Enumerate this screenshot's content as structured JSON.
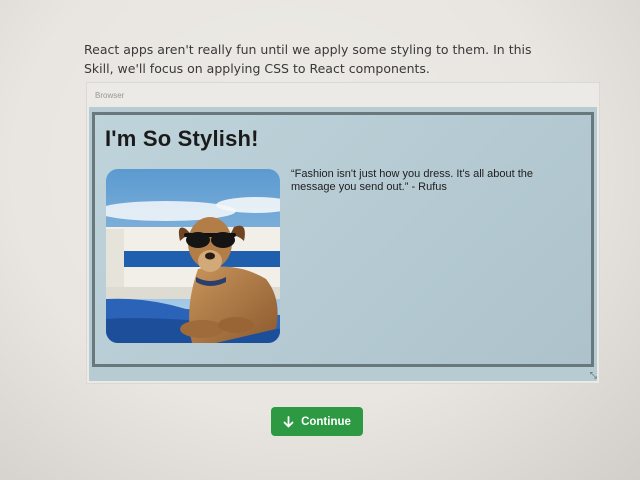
{
  "intro": {
    "text": "React apps aren't really fun until we apply some styling to them. In this Skill, we'll focus on applying CSS to React components."
  },
  "browser": {
    "tab_label": "Browser",
    "app": {
      "title": "I'm So Stylish!",
      "quote": "“Fashion isn't just how you dress. It's all about the message you send out.” - Rufus"
    }
  },
  "continue_button": {
    "label": "Continue",
    "icon": "arrow-down-icon"
  },
  "colors": {
    "viewport_bg": "#b7cbd3",
    "frame_border": "#69787c",
    "button_green": "#2d9a43"
  }
}
